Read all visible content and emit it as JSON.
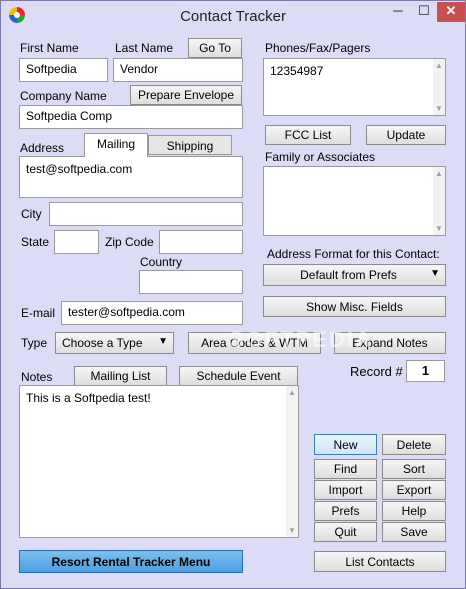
{
  "window": {
    "title": "Contact Tracker",
    "min_glyph": "─",
    "max_glyph": "☐",
    "close_glyph": "✕",
    "app_icon": "contact-tracker-app-icon"
  },
  "name": {
    "first_label": "First Name",
    "first_value": "Softpedia",
    "last_label": "Last Name",
    "last_value": "Vendor",
    "goto_label": "Go To"
  },
  "company": {
    "label": "Company Name",
    "value": "Softpedia Comp",
    "envelope_label": "Prepare Envelope"
  },
  "address": {
    "label": "Address",
    "tabs": [
      "Mailing",
      "Shipping"
    ],
    "active_tab": "Mailing",
    "value": "test@softpedia.com"
  },
  "city": {
    "label": "City",
    "value": ""
  },
  "state": {
    "label": "State",
    "value": ""
  },
  "zip": {
    "label": "Zip Code",
    "value": ""
  },
  "country": {
    "label": "Country",
    "value": ""
  },
  "email": {
    "label": "E-mail",
    "value": "tester@softpedia.com"
  },
  "type": {
    "label": "Type",
    "value": "Choose a Type"
  },
  "area_codes_label": "Area Codes & WTM",
  "expand_notes_label": "Expand Notes",
  "notes": {
    "label": "Notes",
    "mailing_list_label": "Mailing List",
    "schedule_label": "Schedule Event",
    "value": "This is a Softpedia test!"
  },
  "phones": {
    "label": "Phones/Fax/Pagers",
    "value": "12354987"
  },
  "fcc_label": "FCC List",
  "update_label": "Update",
  "family": {
    "label": "Family or Associates",
    "value": ""
  },
  "address_format": {
    "label": "Address Format for this Contact:",
    "value": "Default from Prefs"
  },
  "misc_label": "Show Misc. Fields",
  "record": {
    "label": "Record #",
    "value": "1"
  },
  "actions": {
    "new": "New",
    "delete": "Delete",
    "find": "Find",
    "sort": "Sort",
    "import": "Import",
    "export": "Export",
    "prefs": "Prefs",
    "help": "Help",
    "quit": "Quit",
    "save": "Save"
  },
  "resort_label": "Resort Rental Tracker Menu",
  "list_contacts_label": "List Contacts",
  "watermark": "SOFTPEDIA"
}
